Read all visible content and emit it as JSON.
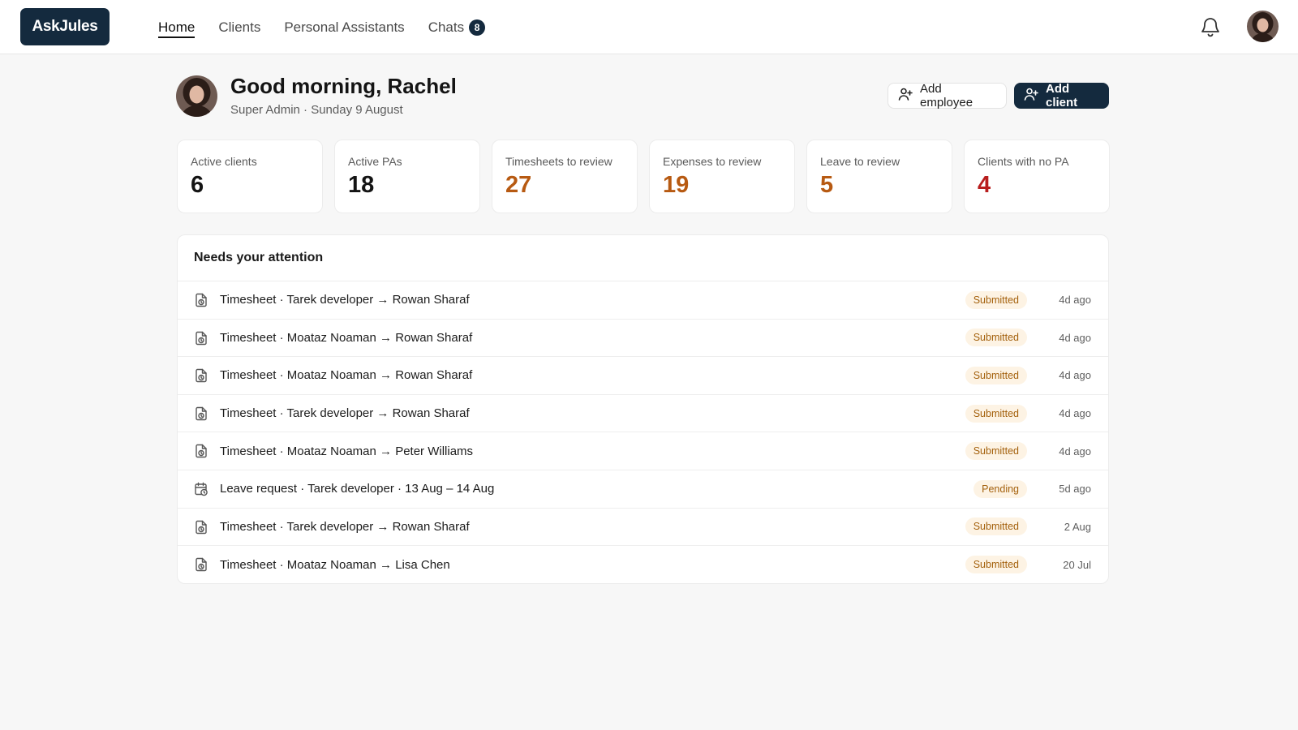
{
  "app": {
    "logo": "AskJules"
  },
  "nav": {
    "items": [
      {
        "label": "Home",
        "active": true
      },
      {
        "label": "Clients"
      },
      {
        "label": "Personal Assistants"
      },
      {
        "label": "Chats",
        "badge": "8"
      }
    ]
  },
  "header_icons": {
    "notifications": "bell-icon",
    "profile": "avatar"
  },
  "greeting": {
    "title": "Good morning, Rachel",
    "subtitle": "Super Admin · Sunday 9 August"
  },
  "actions": {
    "add_employee": "Add employee",
    "add_client": "Add client"
  },
  "stats": [
    {
      "label": "Active clients",
      "value": "6"
    },
    {
      "label": "Active PAs",
      "value": "18"
    },
    {
      "label": "Timesheets to review",
      "value": "27",
      "color": "#b75a12"
    },
    {
      "label": "Expenses to review",
      "value": "19",
      "color": "#b75a12"
    },
    {
      "label": "Leave to review",
      "value": "5",
      "color": "#b75a12"
    },
    {
      "label": "Clients with no PA",
      "value": "4",
      "color": "#b81e1e"
    }
  ],
  "attention": {
    "title": "Needs your attention",
    "items": [
      {
        "icon": "clock-document-icon",
        "text": "Timesheet · Tarek developer → Rowan Sharaf",
        "status": "Submitted",
        "time": "4d ago"
      },
      {
        "icon": "clock-document-icon",
        "text": "Timesheet · Moataz Noaman → Rowan Sharaf",
        "status": "Submitted",
        "time": "4d ago"
      },
      {
        "icon": "clock-document-icon",
        "text": "Timesheet · Moataz Noaman → Rowan Sharaf",
        "status": "Submitted",
        "time": "4d ago"
      },
      {
        "icon": "clock-document-icon",
        "text": "Timesheet · Tarek developer → Rowan Sharaf",
        "status": "Submitted",
        "time": "4d ago"
      },
      {
        "icon": "clock-document-icon",
        "text": "Timesheet · Moataz Noaman → Peter Williams",
        "status": "Submitted",
        "time": "4d ago"
      },
      {
        "icon": "calendar-clock-icon",
        "text": "Leave request · Tarek developer · 13 Aug – 14 Aug",
        "status": "Pending",
        "time": "5d ago"
      },
      {
        "icon": "clock-document-icon",
        "text": "Timesheet · Tarek developer → Rowan Sharaf",
        "status": "Submitted",
        "time": "2 Aug"
      },
      {
        "icon": "clock-document-icon",
        "text": "Timesheet · Moataz Noaman → Lisa Chen",
        "status": "Submitted",
        "time": "20 Jul"
      }
    ]
  },
  "colors": {
    "brand": "#142a3e",
    "warning": "#b75a12",
    "danger": "#b81e1e",
    "status_bg": "#fdf3e4",
    "status_text": "#a4610d"
  }
}
